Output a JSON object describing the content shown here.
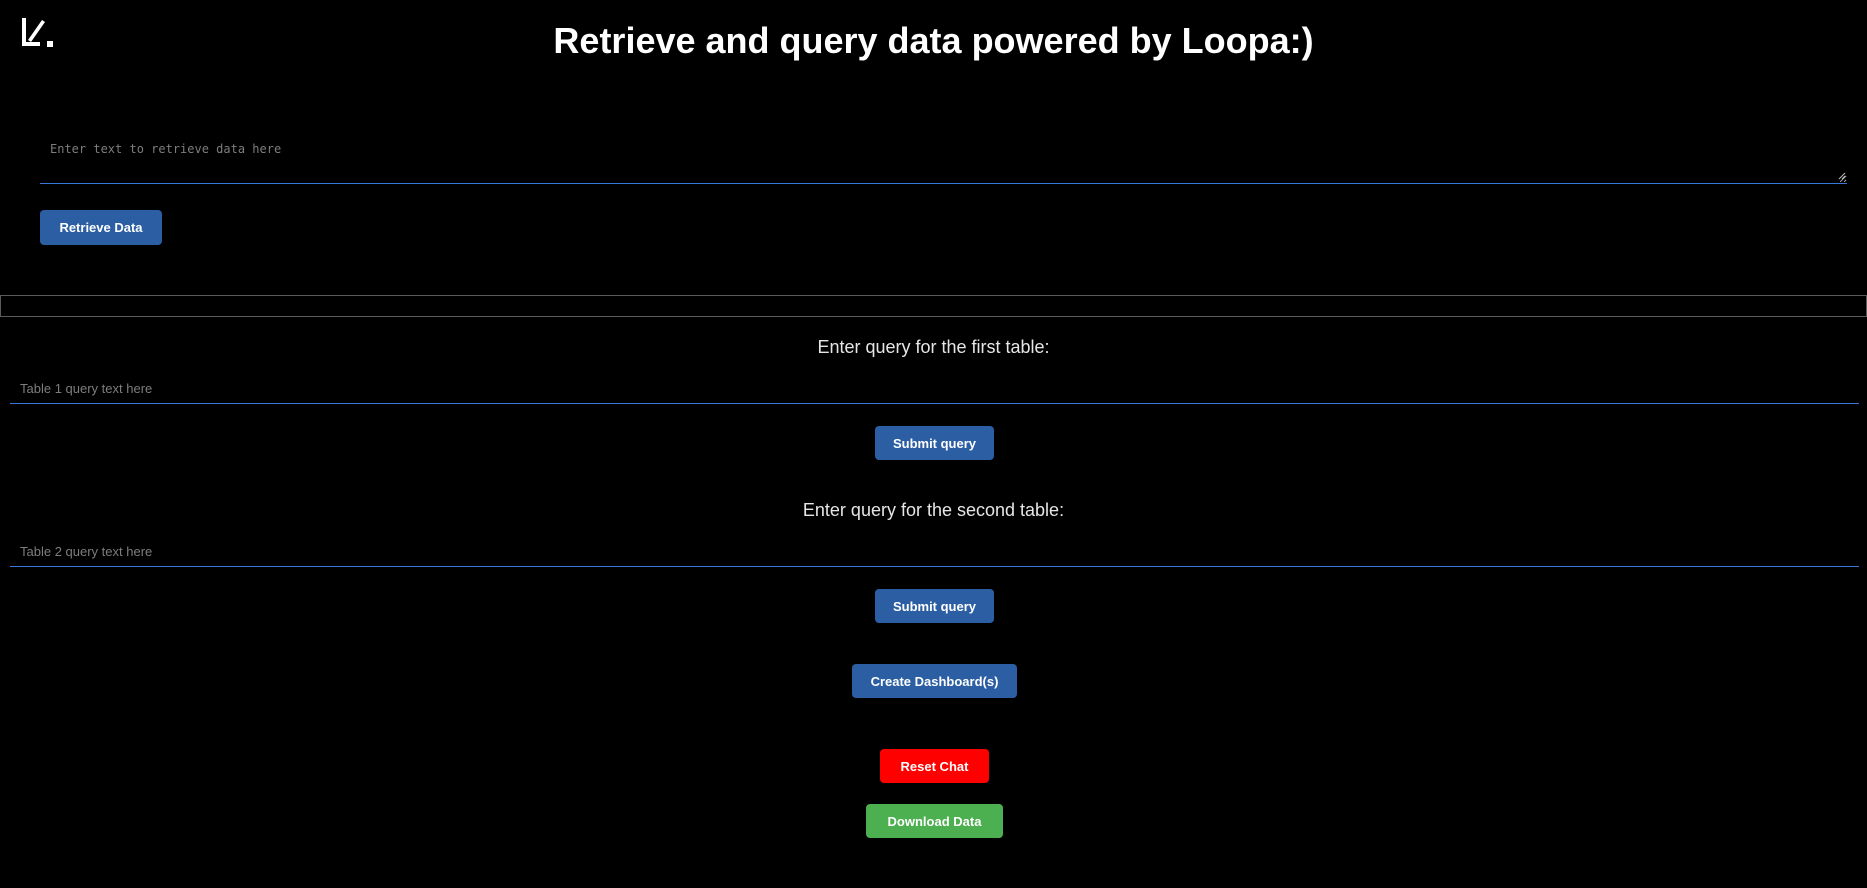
{
  "header": {
    "logo_icon": "loopa-logo-icon",
    "title": "Retrieve and query data powered by Loopa:)"
  },
  "retrieve": {
    "placeholder": "Enter text to retrieve data here",
    "value": "",
    "button_label": "Retrieve Data"
  },
  "table1": {
    "label": "Enter query for the first table:",
    "placeholder": "Table 1 query text here",
    "value": "",
    "submit_label": "Submit query"
  },
  "table2": {
    "label": "Enter query for the second table:",
    "placeholder": "Table 2 query text here",
    "value": "",
    "submit_label": "Submit query"
  },
  "actions": {
    "dashboard_label": "Create Dashboard(s)",
    "reset_label": "Reset Chat",
    "download_label": "Download Data"
  },
  "colors": {
    "background": "#000000",
    "primary_button": "#2b5ea3",
    "reset_button": "#ff0000",
    "download_button": "#4caf50",
    "input_underline": "#3a78d8"
  }
}
